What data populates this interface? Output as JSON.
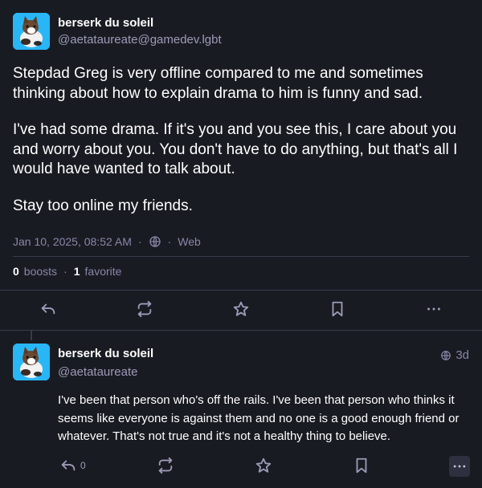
{
  "main_post": {
    "display_name": "berserk du soleil",
    "acct": "@aetataureate@gamedev.lgbt",
    "paragraphs": [
      "Stepdad Greg is very offline compared to me and sometimes thinking about how to explain drama to him is funny and sad.",
      "I've had some drama. If it's you and you see this, I care about you and worry about you. You don't have to do anything, but that's all I would have wanted to talk about.",
      "Stay too online my friends."
    ],
    "timestamp": "Jan 10, 2025, 08:52 AM",
    "visibility_icon": "globe-icon",
    "application": "Web",
    "boosts_count": "0",
    "boosts_label": "boosts",
    "favorites_count": "1",
    "favorites_label": "favorite"
  },
  "reply": {
    "display_name": "berserk du soleil",
    "acct": "@aetataureate",
    "relative_time": "3d",
    "text": "I've been that person who's off the rails. I've been that person who thinks it seems like everyone is against them and no one is a good enough friend or whatever. That's not true and it's not a healthy thing to believe.",
    "replies_count": "0"
  },
  "colors": {
    "background": "#191b22",
    "secondary_text": "#9c9bb8",
    "divider": "#393b4b",
    "avatar_bg": "#29b6f6"
  }
}
